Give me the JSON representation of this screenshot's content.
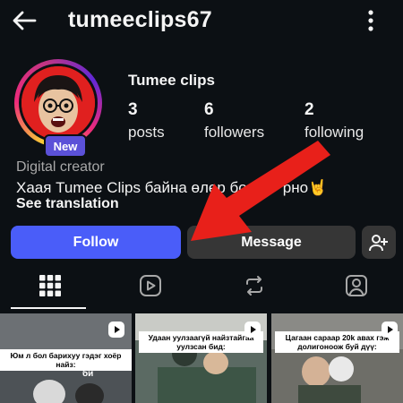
{
  "header": {
    "username": "tumeeclips67"
  },
  "profile": {
    "display_name": "Tumee clips",
    "badge": "New",
    "stats": [
      {
        "value": "3",
        "label": "posts"
      },
      {
        "value": "6",
        "label": "followers"
      },
      {
        "value": "2",
        "label": "following"
      }
    ],
    "category": "Digital creator",
    "bio": "Хаая Tumee Clips байна өлөр бо",
    "bio_tail": "рно🤘",
    "see_translation": "See translation"
  },
  "actions": {
    "follow": "Follow",
    "message": "Message"
  },
  "tabs": [
    "grid-icon",
    "reels-icon",
    "reposts-icon",
    "tagged-icon"
  ],
  "grid": [
    {
      "caption": "Юм л бол барихуу гэдэг хоёр найз:",
      "overlay_text": "би"
    },
    {
      "caption": "Удаан уулзаагүй найзтайгаа уулзсан бид:"
    },
    {
      "caption": "Цагаан сараар 20k авах гэж долигоноож буй дүү:"
    }
  ],
  "colors": {
    "accent": "#4a5df9",
    "badge": "#5b51d8",
    "arrow": "#e8201a"
  }
}
